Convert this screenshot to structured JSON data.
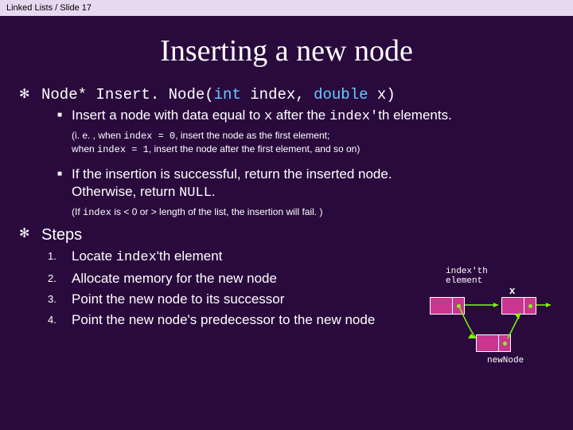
{
  "breadcrumb": "Linked Lists / Slide 17",
  "title": "Inserting a new node",
  "signature": {
    "ret": "Node* ",
    "fn": "Insert. Node(",
    "t1": "int",
    "p1": " index, ",
    "t2": "double",
    "p2": " x)"
  },
  "desc1": {
    "a": "Insert a node with data equal to ",
    "x": "x",
    "b": " after the ",
    "idx": "index'",
    "c": "th   elements."
  },
  "note1": {
    "a": "(i. e. , when ",
    "code1": "index = 0",
    "b": ", insert the node as the first element;",
    "c": "when ",
    "code2": "index = 1",
    "d": ", insert the node after the first element, and so on)"
  },
  "desc2": {
    "a": "If the insertion is successful, return the inserted node.",
    "b": " Otherwise, return ",
    "null": "NULL",
    "c": "."
  },
  "note2": {
    "a": "(If ",
    "code": "index",
    "b": " is < 0 or > length of the list, the insertion will fail. )"
  },
  "steps_header": "Steps",
  "steps": {
    "s1a": "Locate ",
    "s1code": "index",
    "s1b": "'th element",
    "s2": "Allocate memory for the new node",
    "s3": "Point the new node to its successor",
    "s4": "Point the new node's predecessor to the new node"
  },
  "nums": {
    "n1": "1.",
    "n2": "2.",
    "n3": "3.",
    "n4": "4."
  },
  "diagram": {
    "top_label": "index'th\nelement",
    "x": "x",
    "bottom_label": "newNode"
  }
}
